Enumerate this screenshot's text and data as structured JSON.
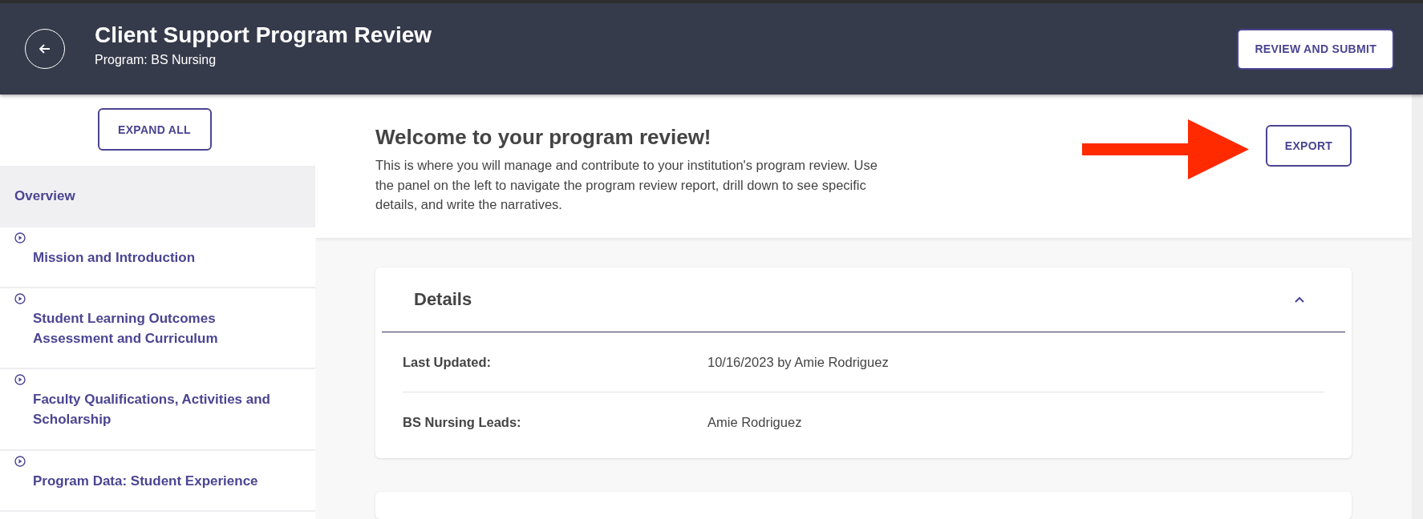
{
  "header": {
    "title": "Client Support Program Review",
    "subtitle": "Program: BS Nursing",
    "action": "REVIEW AND SUBMIT"
  },
  "sidebar": {
    "expand_button": "EXPAND ALL",
    "items": [
      {
        "label": "Overview",
        "kind": "page",
        "selected": true
      },
      {
        "label": "Mission and Introduction",
        "kind": "section",
        "selected": false
      },
      {
        "label": "Student Learning Outcomes Assessment and Curriculum",
        "kind": "section",
        "selected": false
      },
      {
        "label": "Faculty Qualifications, Activities and Scholarship",
        "kind": "section",
        "selected": false
      },
      {
        "label": "Program Data: Student Experience",
        "kind": "section",
        "selected": false
      }
    ]
  },
  "welcome": {
    "title": "Welcome to your program review!",
    "text": "This is where you will manage and contribute to your institution's program review. Use the panel on the left to navigate the program review report, drill down to see specific details, and write the narratives.",
    "export_button": "EXPORT"
  },
  "details": {
    "title": "Details",
    "expanded": true,
    "rows": [
      {
        "label": "Last Updated:",
        "value": "10/16/2023 by Amie Rodriguez"
      },
      {
        "label": "BS Nursing Leads:",
        "value": "Amie Rodriguez"
      }
    ]
  }
}
